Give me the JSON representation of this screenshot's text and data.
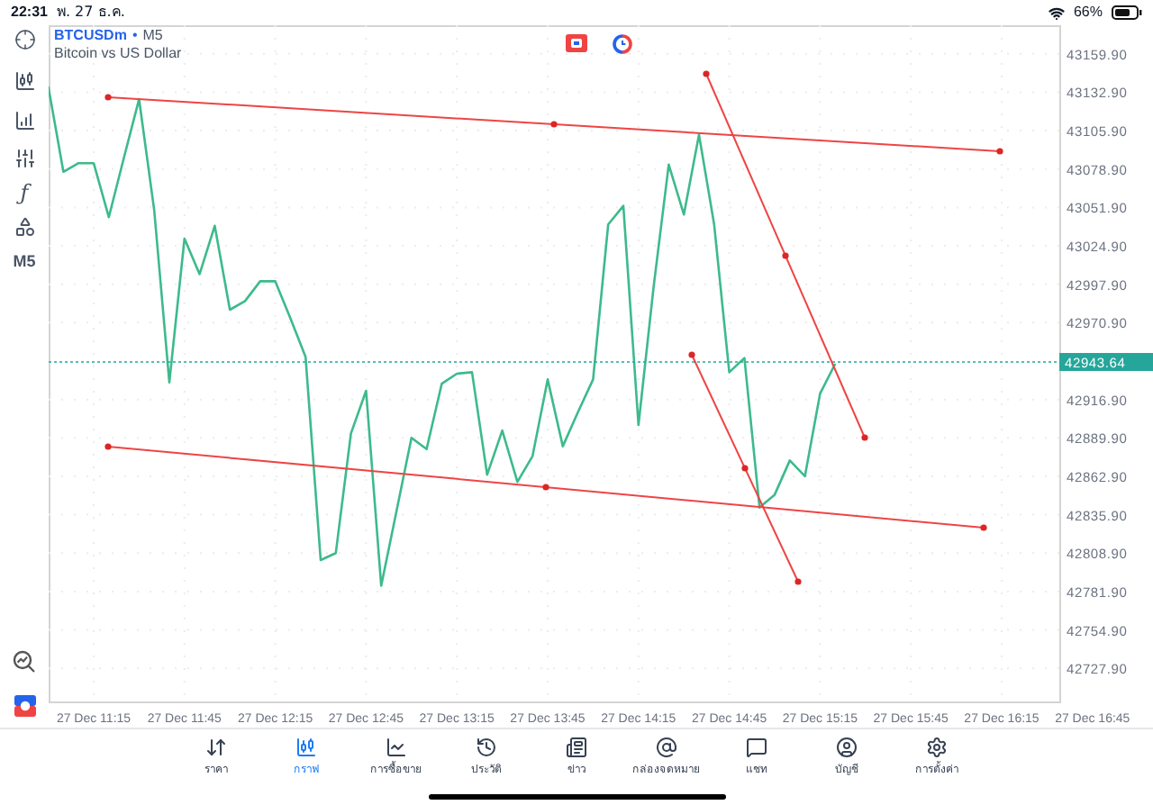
{
  "status_bar": {
    "time": "22:31",
    "date": "พ. 27 ธ.ค.",
    "battery": "66%"
  },
  "chart_header": {
    "symbol": "BTCUSDm",
    "separator": "•",
    "timeframe": "M5",
    "description": "Bitcoin vs US Dollar"
  },
  "toolbar": {
    "indicator_glyph": "ƒ",
    "timeframe": "M5"
  },
  "chart": {
    "chart_data": {
      "type": "line",
      "ylim": [
        42704,
        43180
      ],
      "grid": true,
      "categories": [
        null,
        null,
        null,
        "27 Dec 11:15",
        null,
        null,
        null,
        null,
        null,
        "27 Dec 11:45",
        null,
        null,
        null,
        null,
        null,
        "27 Dec 12:15",
        null,
        null,
        null,
        null,
        null,
        "27 Dec 12:45",
        null,
        null,
        null,
        null,
        null,
        "27 Dec 13:15",
        null,
        null,
        null,
        null,
        null,
        "27 Dec 13:45",
        null,
        null,
        null,
        null,
        null,
        "27 Dec 14:15",
        null,
        null,
        null,
        null,
        null,
        "27 Dec 14:45",
        null,
        null,
        null,
        null,
        null,
        "27 Dec 15:15",
        null,
        null,
        null,
        null,
        null,
        "27 Dec 15:45",
        null,
        null,
        null,
        null,
        null,
        "27 Dec 16:15",
        null,
        null,
        null,
        null,
        null,
        "27 Dec 16:45"
      ],
      "series": [
        {
          "color": "#3dba8c",
          "values": [
            43137,
            43077,
            43083,
            43083,
            43045,
            43087,
            43128,
            43050,
            42929,
            43030,
            43005,
            43039,
            42980,
            42986,
            43000,
            43000,
            42974,
            42947,
            42804,
            42809,
            42893,
            42923,
            42786,
            42838,
            42890,
            42882,
            42928,
            42935,
            42936,
            42864,
            42895,
            42859,
            42877,
            42931,
            42884,
            42908,
            42931,
            43040,
            43053,
            42899,
            42996,
            43082,
            43047,
            43103,
            43040,
            42936,
            42946,
            42841,
            42850,
            42874,
            42863,
            42921,
            42942,
            null,
            null,
            null,
            null,
            null,
            null,
            null,
            null,
            null,
            null,
            null,
            null,
            null,
            null,
            null,
            null,
            null
          ]
        }
      ],
      "yticks": [
        {
          "value": 43159.9,
          "label": "43159.90"
        },
        {
          "value": 43132.9,
          "label": "43132.90"
        },
        {
          "value": 43105.9,
          "label": "43105.90"
        },
        {
          "value": 43078.9,
          "label": "43078.90"
        },
        {
          "value": 43051.9,
          "label": "43051.90"
        },
        {
          "value": 43024.9,
          "label": "43024.90"
        },
        {
          "value": 42997.9,
          "label": "42997.90"
        },
        {
          "value": 42970.9,
          "label": "42970.90"
        },
        {
          "value": 42916.9,
          "label": "42916.90"
        },
        {
          "value": 42889.9,
          "label": "42889.90"
        },
        {
          "value": 42862.9,
          "label": "42862.90"
        },
        {
          "value": 42835.9,
          "label": "42835.90"
        },
        {
          "value": 42808.9,
          "label": "42808.90"
        },
        {
          "value": 42781.9,
          "label": "42781.90"
        },
        {
          "value": 42754.9,
          "label": "42754.90"
        },
        {
          "value": 42727.9,
          "label": "42727.90"
        }
      ]
    },
    "current_price": {
      "label": "42943.64"
    },
    "drawings": [
      {
        "kind": "trendline"
      },
      {
        "kind": "trendline"
      },
      {
        "kind": "trendline"
      },
      {
        "kind": "trendline"
      }
    ]
  },
  "tabs": [
    {
      "label": "ราคา",
      "selected": false
    },
    {
      "label": "กราฟ",
      "selected": true
    },
    {
      "label": "การซื้อขาย",
      "selected": false
    },
    {
      "label": "ประวัติ",
      "selected": false
    },
    {
      "label": "ข่าว",
      "selected": false
    },
    {
      "label": "กล่องจดหมาย",
      "selected": false
    },
    {
      "label": "แชท",
      "selected": false
    },
    {
      "label": "บัญชี",
      "selected": false
    },
    {
      "label": "การตั้งค่า",
      "selected": false
    }
  ]
}
